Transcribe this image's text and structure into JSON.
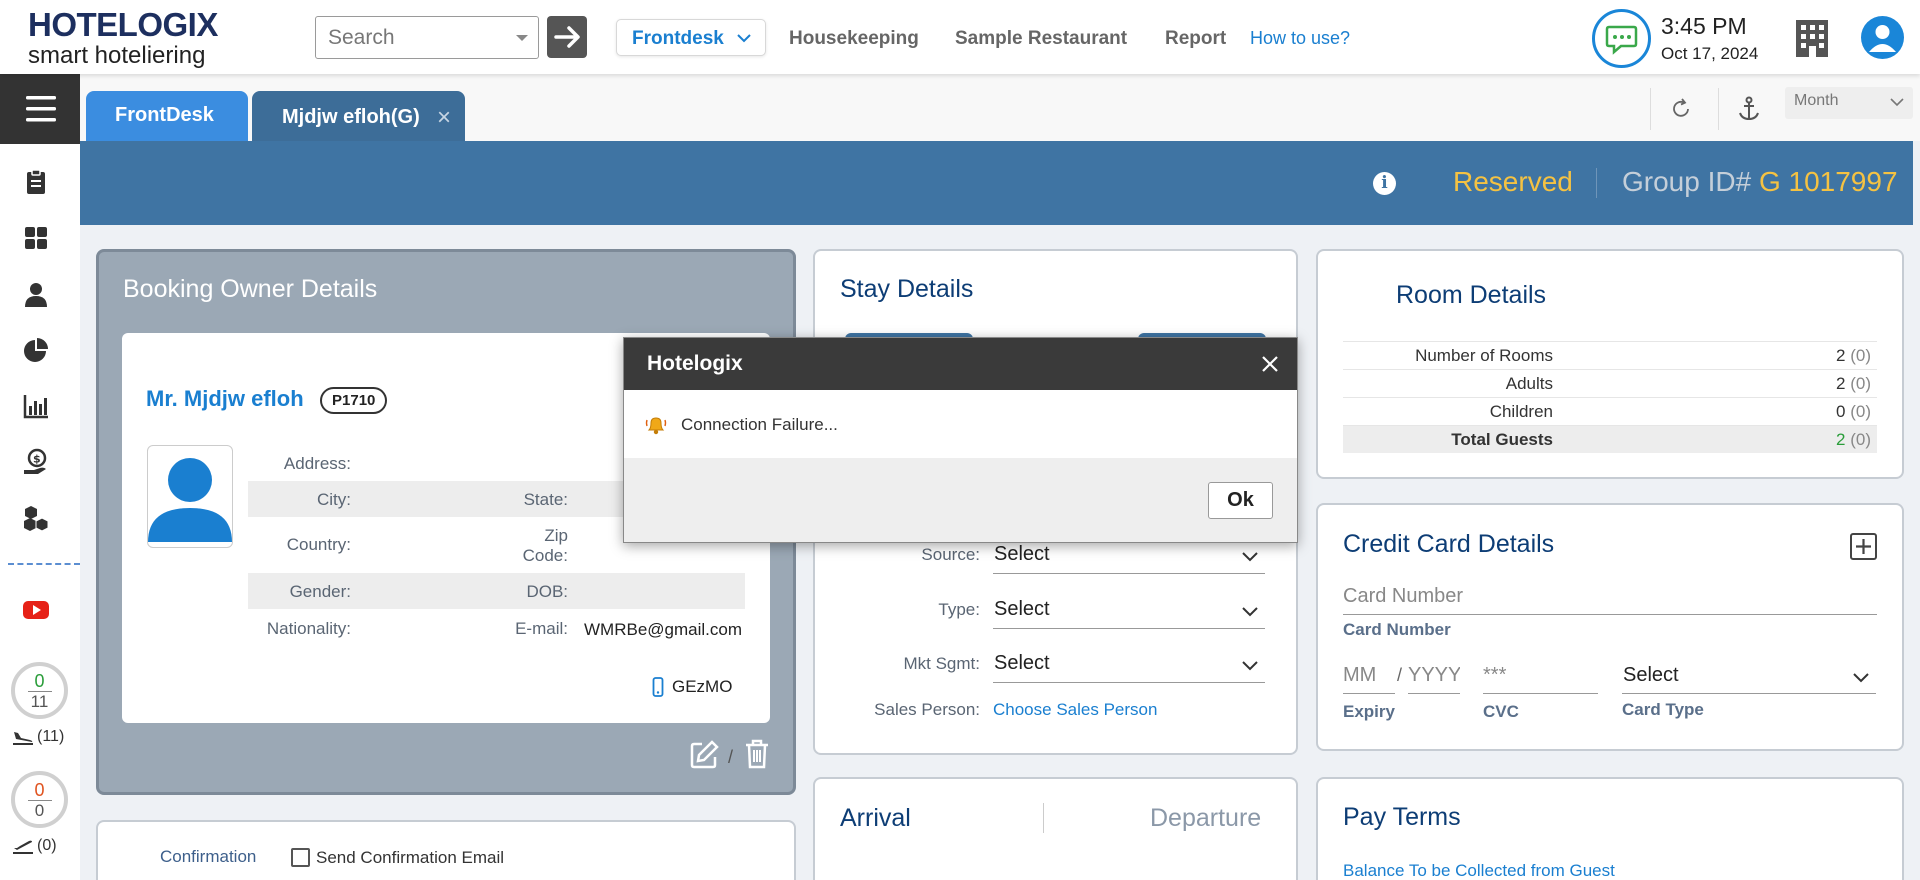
{
  "topbar": {
    "logo_line1": "HOTELOGIX",
    "logo_line2": "smart hoteliering",
    "search_placeholder": "Search",
    "nav_items": [
      "Frontdesk",
      "Housekeeping",
      "Sample Restaurant",
      "Report"
    ],
    "how_to": "How to use?",
    "time": "3:45 PM",
    "date": "Oct 17, 2024"
  },
  "sidebar": {
    "icons": [
      "clipboard-icon",
      "dashboard-icon",
      "person-icon",
      "pie-chart-icon",
      "bar-chart-icon",
      "money-hand-icon",
      "boxes-icon",
      "youtube-icon"
    ],
    "arrivals": {
      "done": "0",
      "total": "11",
      "label": "(11)"
    },
    "departures": {
      "done": "0",
      "total": "0",
      "label": "(0)"
    }
  },
  "tabs": {
    "frontdesk": "FrontDesk",
    "group": "Mjdjw efloh(G)",
    "view_select": "Month"
  },
  "header": {
    "status": "Reserved",
    "group_id_label": "Group ID#",
    "group_id_value": "G 1017997"
  },
  "owner": {
    "title": "Booking Owner Details",
    "name": "Mr. Mjdjw efloh",
    "code": "P1710",
    "labels": {
      "address": "Address:",
      "city": "City:",
      "state": "State:",
      "country": "Country:",
      "zip": "Zip Code:",
      "gender": "Gender:",
      "dob": "DOB:",
      "nationality": "Nationality:",
      "email": "E-mail:"
    },
    "email": "WMRBe@gmail.com",
    "phone": "GEzMO"
  },
  "confirmation": {
    "label": "Confirmation",
    "checkbox": "Send Confirmation Email"
  },
  "stay": {
    "title": "Stay Details",
    "source_label": "Source:",
    "type_label": "Type:",
    "mkt_label": "Mkt Sgmt:",
    "sales_label": "Sales Person:",
    "select": "Select",
    "sales_link": "Choose Sales Person"
  },
  "arrival": {
    "arrival": "Arrival",
    "departure": "Departure"
  },
  "room": {
    "title": "Room Details",
    "rows": [
      {
        "label": "Number of Rooms",
        "value": "2",
        "sub": "(0)"
      },
      {
        "label": "Adults",
        "value": "2",
        "sub": "(0)"
      },
      {
        "label": "Children",
        "value": "0",
        "sub": "(0)"
      },
      {
        "label": "Total Guests",
        "value": "2",
        "sub": "(0)"
      }
    ]
  },
  "card": {
    "title": "Credit Card Details",
    "number_placeholder": "Card Number",
    "number_label": "Card Number",
    "mm_placeholder": "MM",
    "slash": "/",
    "yyyy_placeholder": "YYYY",
    "cvc_placeholder": "***",
    "expiry_label": "Expiry",
    "cvc_label": "CVC",
    "type_select": "Select",
    "type_label": "Card Type"
  },
  "pay": {
    "title": "Pay Terms",
    "link": "Balance To be Collected from Guest"
  },
  "dialog": {
    "title": "Hotelogix",
    "message": "Connection Failure...",
    "ok": "Ok"
  },
  "colors": {
    "brand_blue": "#1a7fd0",
    "header_blue": "#3f74a3",
    "status_gold": "#f5c242"
  }
}
